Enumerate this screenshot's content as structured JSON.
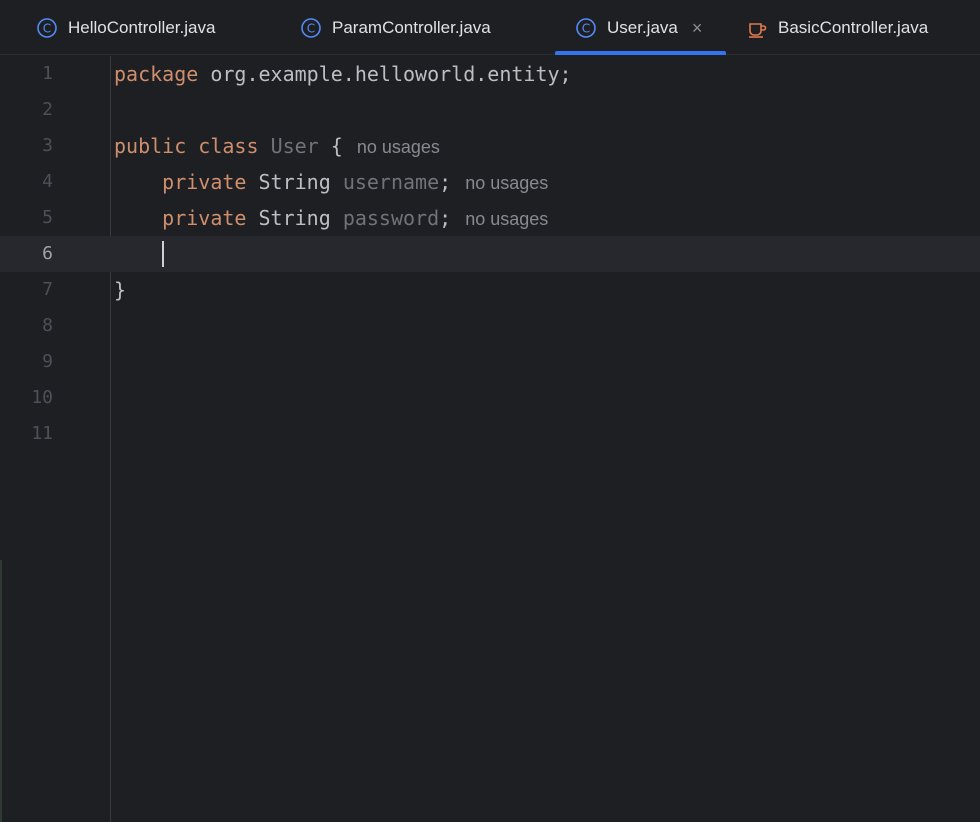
{
  "tabs": [
    {
      "label": "HelloController.java",
      "icon": "class-icon",
      "active": false
    },
    {
      "label": "ParamController.java",
      "icon": "class-icon",
      "active": false
    },
    {
      "label": "User.java",
      "icon": "class-icon",
      "active": true,
      "close": "×"
    },
    {
      "label": "BasicController.java",
      "icon": "java-cup-icon",
      "active": false
    }
  ],
  "editor": {
    "line_numbers": [
      "1",
      "2",
      "3",
      "4",
      "5",
      "6",
      "7",
      "8",
      "9",
      "10",
      "11"
    ],
    "current_line": "6",
    "lines": {
      "l1": {
        "kw": "package",
        "rest": " org.example.helloworld.entity;"
      },
      "l3": {
        "kw1": "public",
        "kw2": "class",
        "name": "User",
        "brace": " {",
        "hint": "no usages"
      },
      "l4": {
        "kw": "private",
        "type": "String",
        "name": "username",
        "semi": ";",
        "hint": "no usages"
      },
      "l5": {
        "kw": "private",
        "type": "String",
        "name": "password",
        "semi": ";",
        "hint": "no usages"
      },
      "l7": {
        "brace": "}"
      }
    }
  },
  "colors": {
    "keyword": "#cf8e6d",
    "text": "#bcbec4",
    "muted": "#6f737a",
    "accent": "#3574f0",
    "background": "#1e1f22"
  }
}
